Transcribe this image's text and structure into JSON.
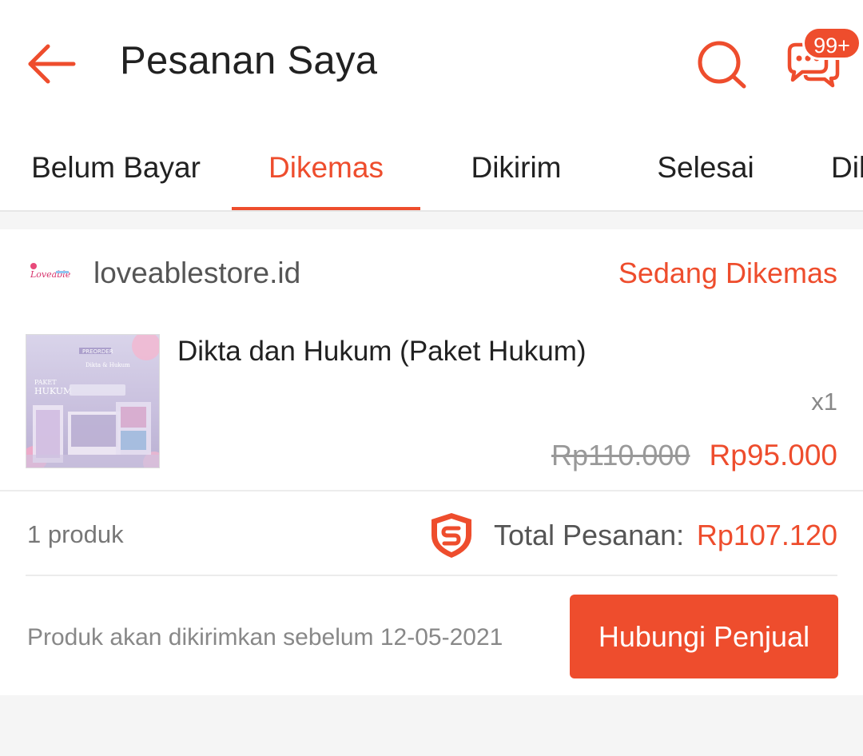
{
  "header": {
    "title": "Pesanan Saya",
    "chat_badge": "99+"
  },
  "tabs": [
    {
      "label": "Belum Bayar",
      "active": false
    },
    {
      "label": "Dikemas",
      "active": true
    },
    {
      "label": "Dikirim",
      "active": false
    },
    {
      "label": "Selesai",
      "active": false
    },
    {
      "label": "Dibatalkan",
      "active": false
    }
  ],
  "order": {
    "shop_name": "loveablestore.id",
    "shop_logo_text": "Loveable",
    "status": "Sedang Dikemas",
    "product": {
      "name": "Dikta dan Hukum (Paket Hukum)",
      "quantity": "x1",
      "price_original": "Rp110.000",
      "price_final": "Rp95.000",
      "thumb_text": {
        "preorder": "PREORDER",
        "title": "Dikta & Hukum",
        "paket": "PAKET",
        "hukum": "HUKUM"
      }
    },
    "item_count": "1 produk",
    "total_label": "Total Pesanan:",
    "total_value": "Rp107.120",
    "delivery_note": "Produk akan dikirimkan sebelum 12-05-2021",
    "contact_button": "Hubungi Penjual"
  },
  "colors": {
    "accent": "#ee4d2d",
    "background": "#f5f5f5",
    "text": "#212121"
  },
  "icons": {
    "back": "arrow-left-icon",
    "search": "search-icon",
    "chat": "chat-icon",
    "guarantee": "shopee-shield-icon"
  }
}
